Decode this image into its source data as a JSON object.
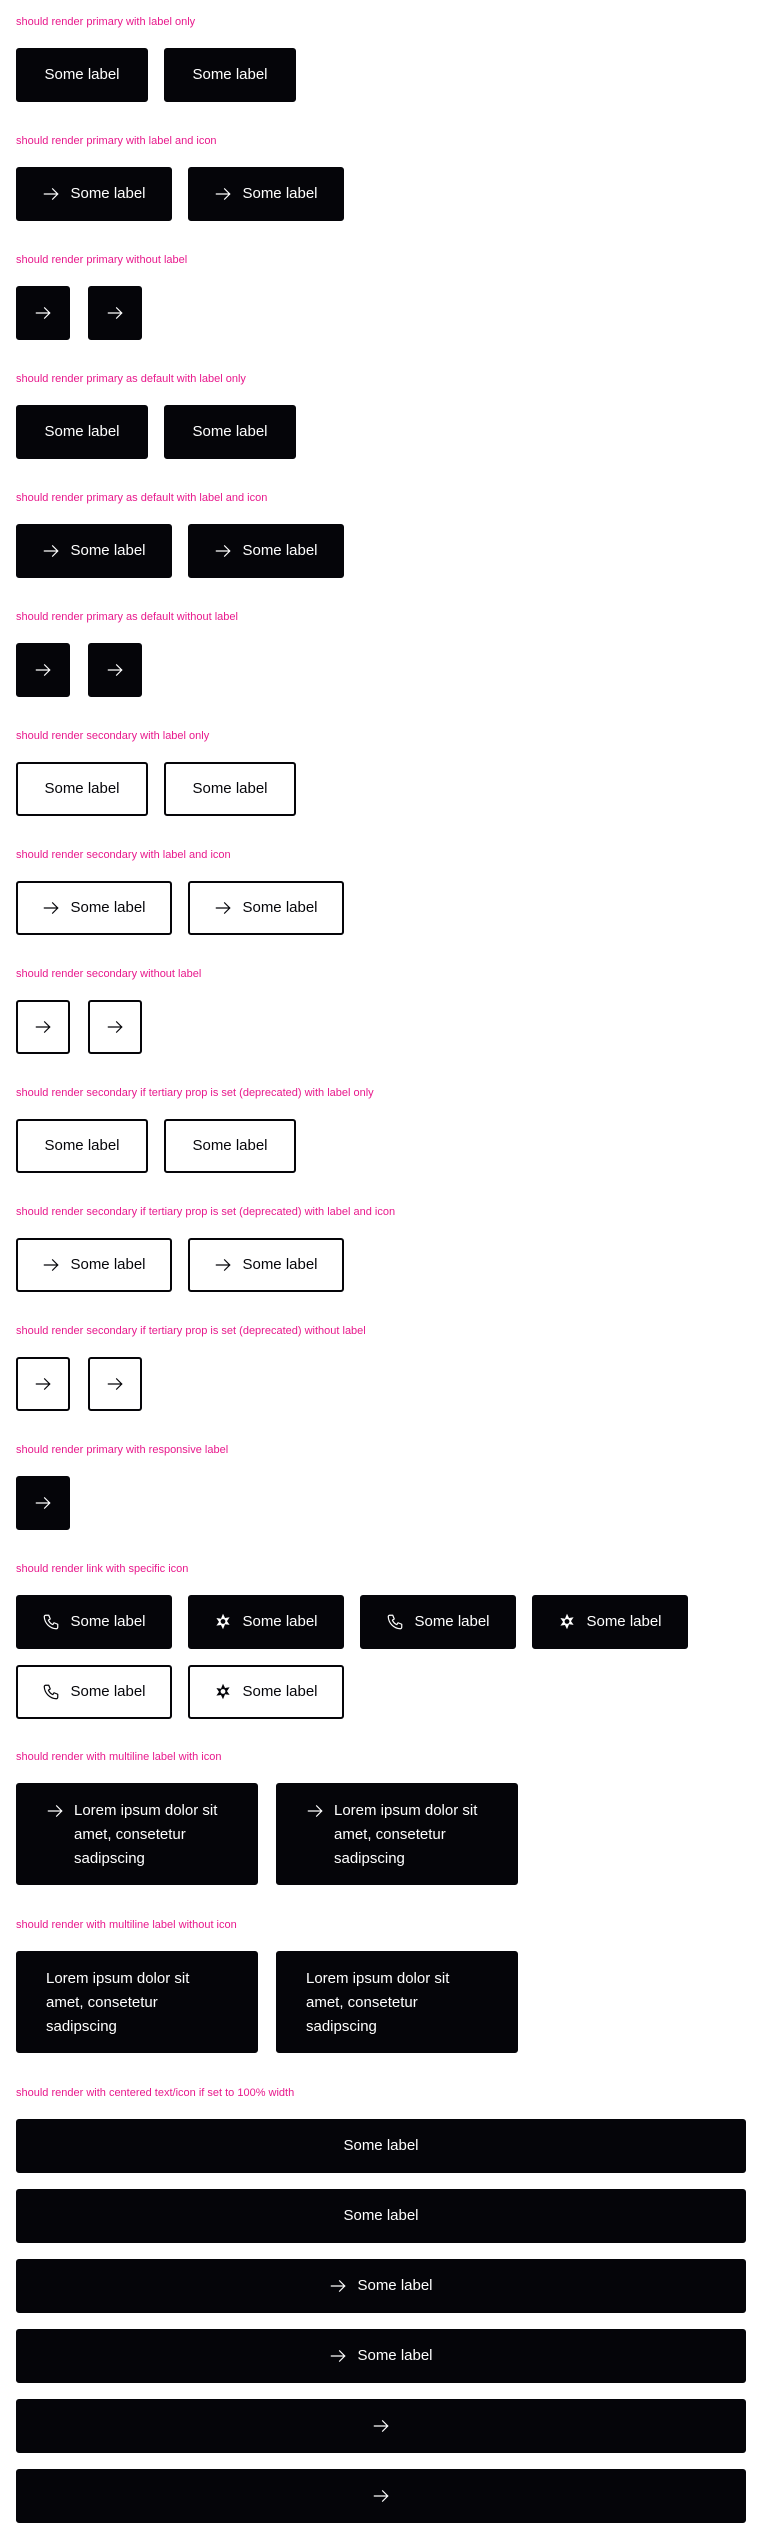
{
  "colors": {
    "caption": "#e8198c",
    "primary": "#050509",
    "on_primary": "#ffffff"
  },
  "icons": {
    "arrow": "arrow-right-icon",
    "phone": "phone-icon",
    "star": "star-burst-icon"
  },
  "sections": [
    {
      "caption": "should render primary with label only",
      "buttons": [
        {
          "variant": "primary",
          "label": "Some label"
        },
        {
          "variant": "primary",
          "label": "Some label"
        }
      ]
    },
    {
      "caption": "should render primary with label and icon",
      "buttons": [
        {
          "variant": "primary",
          "label": "Some label",
          "icon": "arrow-right-icon"
        },
        {
          "variant": "primary",
          "label": "Some label",
          "icon": "arrow-right-icon"
        }
      ]
    },
    {
      "caption": "should render primary without label",
      "buttons": [
        {
          "variant": "primary",
          "icon": "arrow-right-icon"
        },
        {
          "variant": "primary",
          "icon": "arrow-right-icon"
        }
      ]
    },
    {
      "caption": "should render primary as default with label only",
      "buttons": [
        {
          "variant": "primary",
          "label": "Some label"
        },
        {
          "variant": "primary",
          "label": "Some label"
        }
      ]
    },
    {
      "caption": "should render primary as default with label and icon",
      "buttons": [
        {
          "variant": "primary",
          "label": "Some label",
          "icon": "arrow-right-icon"
        },
        {
          "variant": "primary",
          "label": "Some label",
          "icon": "arrow-right-icon"
        }
      ]
    },
    {
      "caption": "should render primary as default without label",
      "buttons": [
        {
          "variant": "primary",
          "icon": "arrow-right-icon"
        },
        {
          "variant": "primary",
          "icon": "arrow-right-icon"
        }
      ]
    },
    {
      "caption": "should render secondary with label only",
      "buttons": [
        {
          "variant": "secondary",
          "label": "Some label"
        },
        {
          "variant": "secondary",
          "label": "Some label"
        }
      ]
    },
    {
      "caption": "should render secondary with label and icon",
      "buttons": [
        {
          "variant": "secondary",
          "label": "Some label",
          "icon": "arrow-right-icon"
        },
        {
          "variant": "secondary",
          "label": "Some label",
          "icon": "arrow-right-icon"
        }
      ]
    },
    {
      "caption": "should render secondary without label",
      "buttons": [
        {
          "variant": "secondary",
          "icon": "arrow-right-icon"
        },
        {
          "variant": "secondary",
          "icon": "arrow-right-icon"
        }
      ]
    },
    {
      "caption": "should render secondary if tertiary prop is set (deprecated) with label only",
      "buttons": [
        {
          "variant": "secondary",
          "label": "Some label"
        },
        {
          "variant": "secondary",
          "label": "Some label"
        }
      ]
    },
    {
      "caption": "should render secondary if tertiary prop is set (deprecated) with label and icon",
      "buttons": [
        {
          "variant": "secondary",
          "label": "Some label",
          "icon": "arrow-right-icon"
        },
        {
          "variant": "secondary",
          "label": "Some label",
          "icon": "arrow-right-icon"
        }
      ]
    },
    {
      "caption": "should render secondary if tertiary prop is set (deprecated) without label",
      "buttons": [
        {
          "variant": "secondary",
          "icon": "arrow-right-icon"
        },
        {
          "variant": "secondary",
          "icon": "arrow-right-icon"
        }
      ]
    },
    {
      "caption": "should render primary with responsive label",
      "buttons": [
        {
          "variant": "primary",
          "icon": "arrow-right-icon"
        }
      ]
    },
    {
      "caption": "should render link with specific icon",
      "buttons": [
        {
          "variant": "primary",
          "label": "Some label",
          "icon": "phone-icon"
        },
        {
          "variant": "primary",
          "label": "Some label",
          "icon": "star-burst-icon"
        },
        {
          "variant": "primary",
          "label": "Some label",
          "icon": "phone-icon"
        },
        {
          "variant": "primary",
          "label": "Some label",
          "icon": "star-burst-icon"
        },
        {
          "variant": "secondary",
          "label": "Some label",
          "icon": "phone-icon"
        },
        {
          "variant": "secondary",
          "label": "Some label",
          "icon": "star-burst-icon"
        }
      ]
    },
    {
      "caption": "should render with multiline label with icon",
      "buttons": [
        {
          "variant": "primary",
          "label": "Lorem ipsum dolor sit amet, consetetur sadipscing",
          "icon": "arrow-right-icon"
        },
        {
          "variant": "primary",
          "label": "Lorem ipsum dolor sit amet, consetetur sadipscing",
          "icon": "arrow-right-icon"
        }
      ]
    },
    {
      "caption": "should render with multiline label without icon",
      "buttons": [
        {
          "variant": "primary",
          "label": "Lorem ipsum dolor sit amet, consetetur sadipscing"
        },
        {
          "variant": "primary",
          "label": "Lorem ipsum dolor sit amet, consetetur sadipscing"
        }
      ]
    },
    {
      "caption": "should render with centered text/icon if set to 100% width",
      "buttons": [
        {
          "variant": "primary",
          "label": "Some label"
        },
        {
          "variant": "primary",
          "label": "Some label"
        },
        {
          "variant": "primary",
          "label": "Some label",
          "icon": "arrow-right-icon"
        },
        {
          "variant": "primary",
          "label": "Some label",
          "icon": "arrow-right-icon"
        },
        {
          "variant": "primary",
          "icon": "arrow-right-icon"
        },
        {
          "variant": "primary",
          "icon": "arrow-right-icon"
        }
      ]
    }
  ]
}
